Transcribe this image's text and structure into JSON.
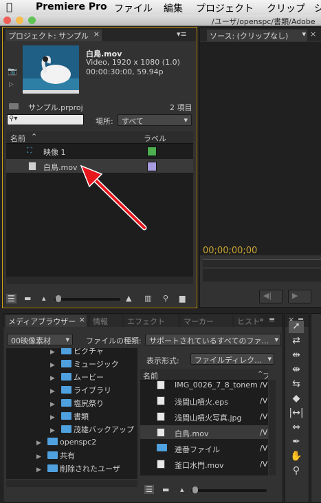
{
  "menubar": {
    "app_name": "Premiere Pro",
    "items": [
      "ファイル",
      "編集",
      "プロジェクト",
      "クリップ",
      "シ"
    ]
  },
  "window": {
    "title": "/ユーザ/openspc/書類/Adobe"
  },
  "project_panel": {
    "tab_label": "プロジェクト: サンプル",
    "clip_name": "白鳥.mov",
    "clip_info_1": "Video, 1920 x 1080 (1.0)",
    "clip_info_2": "00:00:30:00, 59.94p",
    "project_file": "サンプル.prproj",
    "item_count": "2 項目",
    "search_placeholder": "",
    "location_label": "場所:",
    "location_value": "すべて",
    "col_name": "名前",
    "col_label": "ラベル",
    "items": [
      {
        "name": "映像 1",
        "label_color": "#4caf50"
      },
      {
        "name": "白鳥.mov",
        "label_color": "#a99be0"
      }
    ]
  },
  "source_panel": {
    "tab_label": "ソース: (クリップなし)",
    "timecode": "00;00;00;00"
  },
  "media_browser": {
    "tabs": [
      "メディアブラウザー",
      "情報",
      "エフェクト",
      "マーカー",
      "ヒスト"
    ],
    "folder_dropdown": "00映像素材",
    "file_type_label": "ファイルの種類:",
    "file_type_value": "サポートされているすべてのファ...",
    "view_label": "表示形式:",
    "view_value": "ファイルディレク...",
    "tree": [
      "ピクチャ",
      "ミュージック",
      "ムービー",
      "ライブラリ",
      "塩尻祭り",
      "書類",
      "茂雄バックアップ",
      "openspc2",
      "共有",
      "削除されたユーザ"
    ],
    "file_col_name": "名前",
    "file_col_path": "ファ",
    "files": [
      {
        "name": "IMG_0026_7_8_tonem",
        "path": "/V",
        "icon": "image-file-icon"
      },
      {
        "name": "浅間山噴火.eps",
        "path": "/V",
        "icon": "eps-file-icon"
      },
      {
        "name": "浅間山噴火写真.jpg",
        "path": "/V",
        "icon": "jpg-file-icon"
      },
      {
        "name": "白鳥.mov",
        "path": "/V",
        "icon": "video-file-icon"
      },
      {
        "name": "連番ファイル",
        "path": "/V",
        "icon": "folder-icon"
      },
      {
        "name": "釜口水門.mov",
        "path": "/V",
        "icon": "video-file-icon"
      }
    ]
  },
  "tools": [
    "selection-tool",
    "track-select-tool",
    "ripple-edit-tool",
    "rolling-edit-tool",
    "rate-stretch-tool",
    "razor-tool",
    "slip-tool",
    "slide-tool",
    "pen-tool",
    "hand-tool",
    "zoom-tool"
  ]
}
